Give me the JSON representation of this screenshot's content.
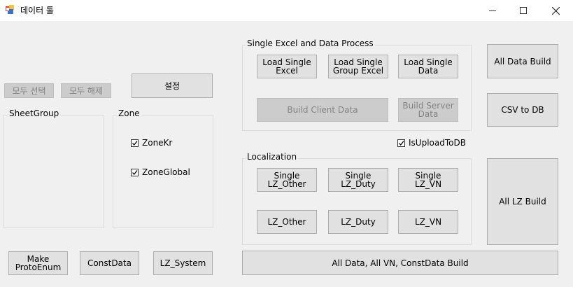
{
  "window": {
    "title": "데이터 툴"
  },
  "left": {
    "select_all": "모두 선택",
    "deselect_all": "모두 해제",
    "settings": "설정",
    "sheetgroup_label": "SheetGroup",
    "zone_label": "Zone",
    "zone_kr": "ZoneKr",
    "zone_global": "ZoneGlobal",
    "make_protoenum": "Make\nProtoEnum",
    "constdata": "ConstData",
    "lz_system": "LZ_System"
  },
  "single_excel": {
    "label": "Single Excel and Data Process",
    "load_single_excel": "Load Single\nExcel",
    "load_single_group_excel": "Load Single\nGroup Excel",
    "load_single_data": "Load Single\nData",
    "build_client_data": "Build Client Data",
    "build_server_data": "Build Server\nData"
  },
  "upload": {
    "is_upload_to_db": "IsUploadToDB"
  },
  "localization": {
    "label": "Localization",
    "single_lz_other": "Single\nLZ_Other",
    "single_lz_duty": "Single\nLZ_Duty",
    "single_lz_vn": "Single\nLZ_VN",
    "lz_other": "LZ_Other",
    "lz_duty": "LZ_Duty",
    "lz_vn": "LZ_VN"
  },
  "right": {
    "all_data_build": "All Data Build",
    "csv_to_db": "CSV to DB",
    "all_lz_build": "All LZ Build"
  },
  "bottom": {
    "all_build": "All Data, All VN, ConstData Build"
  }
}
